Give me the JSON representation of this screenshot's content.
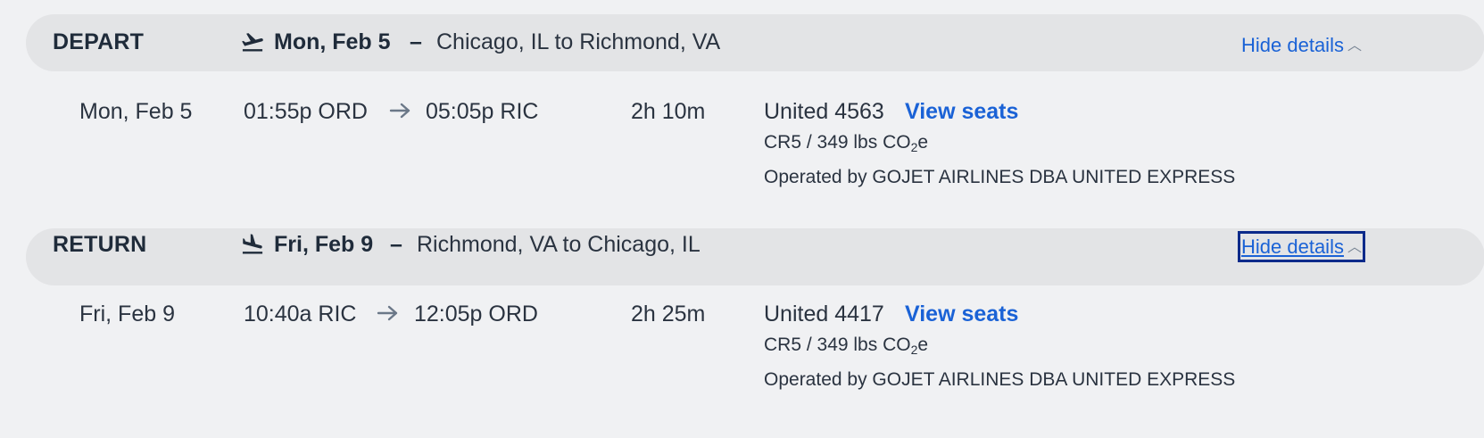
{
  "depart": {
    "label": "DEPART",
    "date": "Mon, Feb 5",
    "dash": "–",
    "route": "Chicago, IL to Richmond, VA",
    "hide_details": "Hide details",
    "segment": {
      "date": "Mon, Feb 5",
      "depart_time": "01:55p ORD",
      "arrive_time": "05:05p RIC",
      "duration": "2h 10m",
      "flight": "United 4563",
      "view_seats": "View seats",
      "aircraft_emissions_prefix": "CR5 / 349 lbs CO",
      "emissions_sub": "2",
      "emissions_suffix": "e",
      "operated_by": "Operated by GOJET AIRLINES DBA UNITED EXPRESS"
    }
  },
  "return": {
    "label": "RETURN",
    "date": "Fri, Feb 9",
    "dash": "–",
    "route": "Richmond, VA to Chicago, IL",
    "hide_details": "Hide details",
    "segment": {
      "date": "Fri, Feb 9",
      "depart_time": "10:40a RIC",
      "arrive_time": "12:05p ORD",
      "duration": "2h 25m",
      "flight": "United 4417",
      "view_seats": "View seats",
      "aircraft_emissions_prefix": "CR5 / 349 lbs CO",
      "emissions_sub": "2",
      "emissions_suffix": "e",
      "operated_by": "Operated by GOJET AIRLINES DBA UNITED EXPRESS"
    }
  },
  "icons": {
    "takeoff": "airplane-takeoff-icon",
    "landing": "airplane-landing-icon",
    "arrow": "arrow-right-icon",
    "chevron": "chevron-up-icon"
  },
  "colors": {
    "link": "#1a62d6",
    "bar_bg": "#e3e4e6",
    "page_bg": "#f0f1f3",
    "focus_outline": "#0b2a8a"
  }
}
